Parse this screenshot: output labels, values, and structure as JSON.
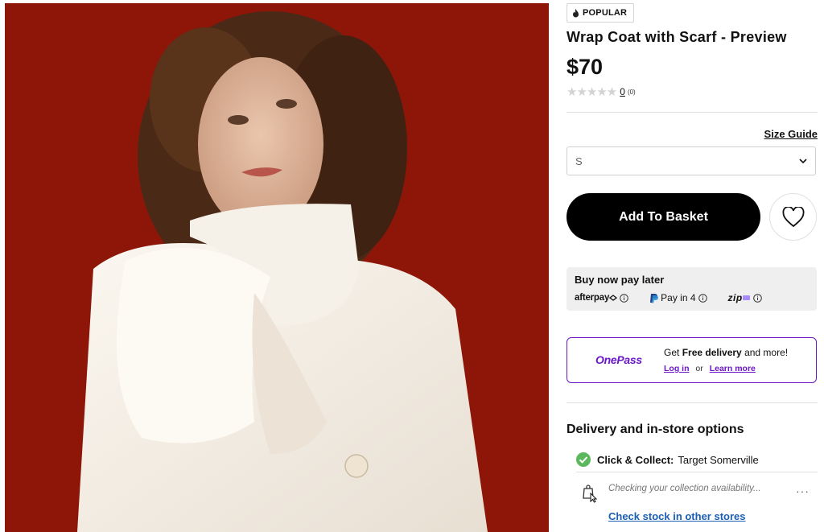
{
  "badge": {
    "label": "POPULAR",
    "icon": "flame-icon"
  },
  "product": {
    "title": "Wrap Coat with Scarf - Preview",
    "price": "$70",
    "rating": {
      "stars_filled": 0,
      "stars_total": 5,
      "review_count": "0",
      "review_count_small": "(0)"
    }
  },
  "size": {
    "guide_label": "Size Guide",
    "selected": "S"
  },
  "actions": {
    "add_to_basket": "Add To Basket",
    "wishlist_icon": "heart-icon"
  },
  "bnpl": {
    "title": "Buy now pay later",
    "providers": [
      {
        "name": "afterpay"
      },
      {
        "name": "Pay in 4"
      },
      {
        "name": "zip"
      }
    ]
  },
  "onepass": {
    "logo": "OnePass",
    "text_prefix": "Get ",
    "text_bold": "Free delivery",
    "text_suffix": " and more!",
    "login": "Log in",
    "or": "or",
    "learn_more": "Learn more",
    "accent": "#6b17c9"
  },
  "delivery": {
    "title": "Delivery and in-store options",
    "click_collect_label": "Click & Collect:",
    "click_collect_store": "Target Somerville",
    "checking_text": "Checking your collection availability...",
    "check_stock_link": "Check stock in other stores"
  },
  "colors": {
    "image_background": "#8d1609",
    "button": "#000000",
    "link": "#1a5fb4",
    "check": "#5cb85c"
  }
}
